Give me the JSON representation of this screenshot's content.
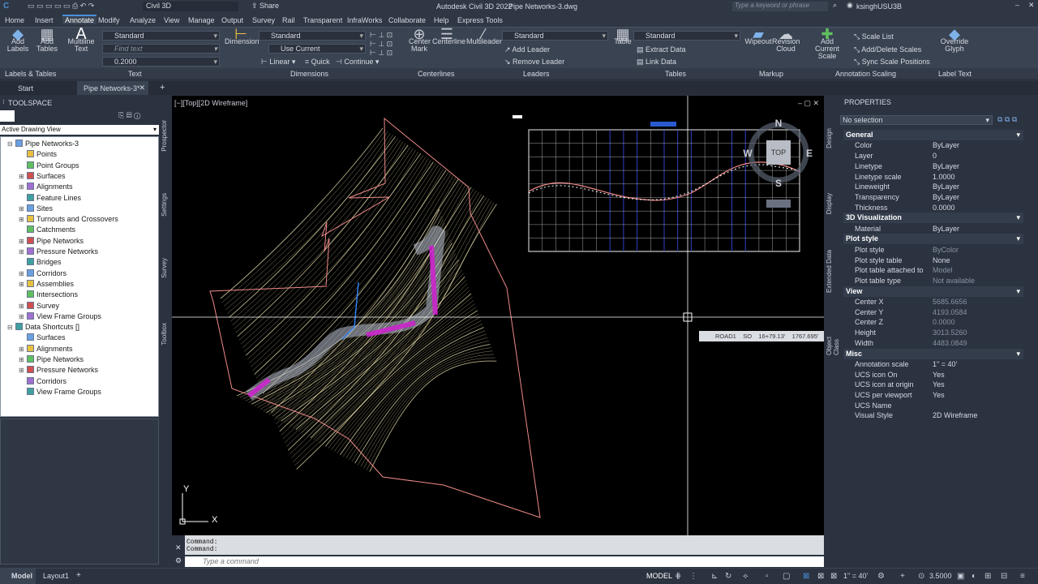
{
  "app_title": "Autodesk Civil 3D 2022",
  "file_title": "Pipe Networks-3.dwg",
  "workspace": "Civil 3D",
  "share_label": "Share",
  "search_placeholder": "Type a keyword or phrase",
  "user_name": "ksinghUSU3B",
  "menus": [
    "Home",
    "Insert",
    "Annotate",
    "Modify",
    "Analyze",
    "View",
    "Manage",
    "Output",
    "Survey",
    "Rail",
    "Transparent",
    "InfraWorks",
    "Collaborate",
    "Help",
    "Express Tools"
  ],
  "active_menu": "Annotate",
  "ribbon": {
    "add_labels": "Add\nLabels",
    "add_tables": "Add\nTables",
    "mtext": "Multiline\nText",
    "text_style": "Standard",
    "find_text": "Find text",
    "text_height": "0.2000",
    "dimension": "Dimension",
    "dim_style": "Standard",
    "use_current": "Use Current",
    "linear": "Linear",
    "quick": "Quick",
    "continue": "Continue",
    "center_mark": "Center\nMark",
    "centerline": "Centerline",
    "multileader": "Multileader",
    "leader_style": "Standard",
    "add_leader": "Add Leader",
    "remove_leader": "Remove Leader",
    "table": "Table",
    "table_style": "Standard",
    "extract_data": "Extract Data",
    "link_data": "Link Data",
    "wipeout": "Wipeout",
    "revision_cloud": "Revision\nCloud",
    "add_current_scale": "Add\nCurrent Scale",
    "scale_list": "Scale List",
    "add_delete_scales": "Add/Delete Scales",
    "sync_scale": "Sync Scale Positions",
    "override_glyph": "Override Glyph"
  },
  "panels": [
    "Labels & Tables",
    "Text",
    "Dimensions",
    "Centerlines",
    "Leaders",
    "Tables",
    "Markup",
    "Annotation Scaling",
    "Label Text"
  ],
  "file_tabs": [
    "Start",
    "Pipe Networks-3*"
  ],
  "toolspace": {
    "title": "TOOLSPACE",
    "view": "Active Drawing View",
    "tabs": [
      "Prospector",
      "Settings",
      "Survey",
      "Toolbox"
    ],
    "tree": [
      {
        "label": "Pipe Networks-3",
        "level": 0,
        "exp": "-"
      },
      {
        "label": "Points",
        "level": 1,
        "exp": ""
      },
      {
        "label": "Point Groups",
        "level": 1,
        "exp": ""
      },
      {
        "label": "Surfaces",
        "level": 1,
        "exp": "+"
      },
      {
        "label": "Alignments",
        "level": 1,
        "exp": "+"
      },
      {
        "label": "Feature Lines",
        "level": 1,
        "exp": ""
      },
      {
        "label": "Sites",
        "level": 1,
        "exp": "+"
      },
      {
        "label": "Turnouts and Crossovers",
        "level": 1,
        "exp": "+"
      },
      {
        "label": "Catchments",
        "level": 1,
        "exp": ""
      },
      {
        "label": "Pipe Networks",
        "level": 1,
        "exp": "+"
      },
      {
        "label": "Pressure Networks",
        "level": 1,
        "exp": "+"
      },
      {
        "label": "Bridges",
        "level": 1,
        "exp": ""
      },
      {
        "label": "Corridors",
        "level": 1,
        "exp": "+"
      },
      {
        "label": "Assemblies",
        "level": 1,
        "exp": "+"
      },
      {
        "label": "Intersections",
        "level": 1,
        "exp": ""
      },
      {
        "label": "Survey",
        "level": 1,
        "exp": "+"
      },
      {
        "label": "View Frame Groups",
        "level": 1,
        "exp": "+"
      },
      {
        "label": "Data Shortcuts []",
        "level": 0,
        "exp": "-"
      },
      {
        "label": "Surfaces",
        "level": 1,
        "exp": ""
      },
      {
        "label": "Alignments",
        "level": 1,
        "exp": "+"
      },
      {
        "label": "Pipe Networks",
        "level": 1,
        "exp": "+"
      },
      {
        "label": "Pressure Networks",
        "level": 1,
        "exp": "+"
      },
      {
        "label": "Corridors",
        "level": 1,
        "exp": ""
      },
      {
        "label": "View Frame Groups",
        "level": 1,
        "exp": ""
      }
    ]
  },
  "viewport_label": "[−][Top][2D Wireframe]",
  "viewcube": {
    "n": "N",
    "s": "S",
    "e": "E",
    "w": "W",
    "top": "TOP"
  },
  "tooltip": {
    "a": "ROAD1",
    "b": "SO",
    "c": "16+79.13'",
    "d": "1767.695'"
  },
  "ucs": {
    "x": "X",
    "y": "Y"
  },
  "command": {
    "line1": "Command:",
    "line2": "Command:",
    "placeholder": "Type a command"
  },
  "properties": {
    "title": "PROPERTIES",
    "selection": "No selection",
    "side_tabs": [
      "Design",
      "Display",
      "Extended Data",
      "Object Class"
    ],
    "sections": [
      {
        "name": "General",
        "rows": [
          [
            "Color",
            "ByLayer",
            false
          ],
          [
            "Layer",
            "0",
            false
          ],
          [
            "Linetype",
            "ByLayer",
            false
          ],
          [
            "Linetype scale",
            "1.0000",
            false
          ],
          [
            "Lineweight",
            "ByLayer",
            false
          ],
          [
            "Transparency",
            "ByLayer",
            false
          ],
          [
            "Thickness",
            "0.0000",
            false
          ]
        ]
      },
      {
        "name": "3D Visualization",
        "rows": [
          [
            "Material",
            "ByLayer",
            false
          ]
        ]
      },
      {
        "name": "Plot style",
        "rows": [
          [
            "Plot style",
            "ByColor",
            true
          ],
          [
            "Plot style table",
            "None",
            false
          ],
          [
            "Plot table attached to",
            "Model",
            true
          ],
          [
            "Plot table type",
            "Not available",
            true
          ]
        ]
      },
      {
        "name": "View",
        "rows": [
          [
            "Center X",
            "5685.6656",
            true
          ],
          [
            "Center Y",
            "4193.0584",
            true
          ],
          [
            "Center Z",
            "0.0000",
            true
          ],
          [
            "Height",
            "3013.5260",
            true
          ],
          [
            "Width",
            "4483.0849",
            true
          ]
        ]
      },
      {
        "name": "Misc",
        "rows": [
          [
            "Annotation scale",
            "1\" = 40'",
            false
          ],
          [
            "UCS icon On",
            "Yes",
            false
          ],
          [
            "UCS icon at origin",
            "Yes",
            false
          ],
          [
            "UCS per viewport",
            "Yes",
            false
          ],
          [
            "UCS Name",
            "",
            false
          ],
          [
            "Visual Style",
            "2D Wireframe",
            false
          ]
        ]
      }
    ]
  },
  "status": {
    "tabs": [
      "Model",
      "Layout1"
    ],
    "model": "MODEL",
    "scale": "1\" = 40'",
    "zoom": "3.5000"
  },
  "colors": {
    "accent": "#4a90d9",
    "contour": "#e8e2b8",
    "boundary": "#f08a8a",
    "magenta": "#d020d0"
  }
}
